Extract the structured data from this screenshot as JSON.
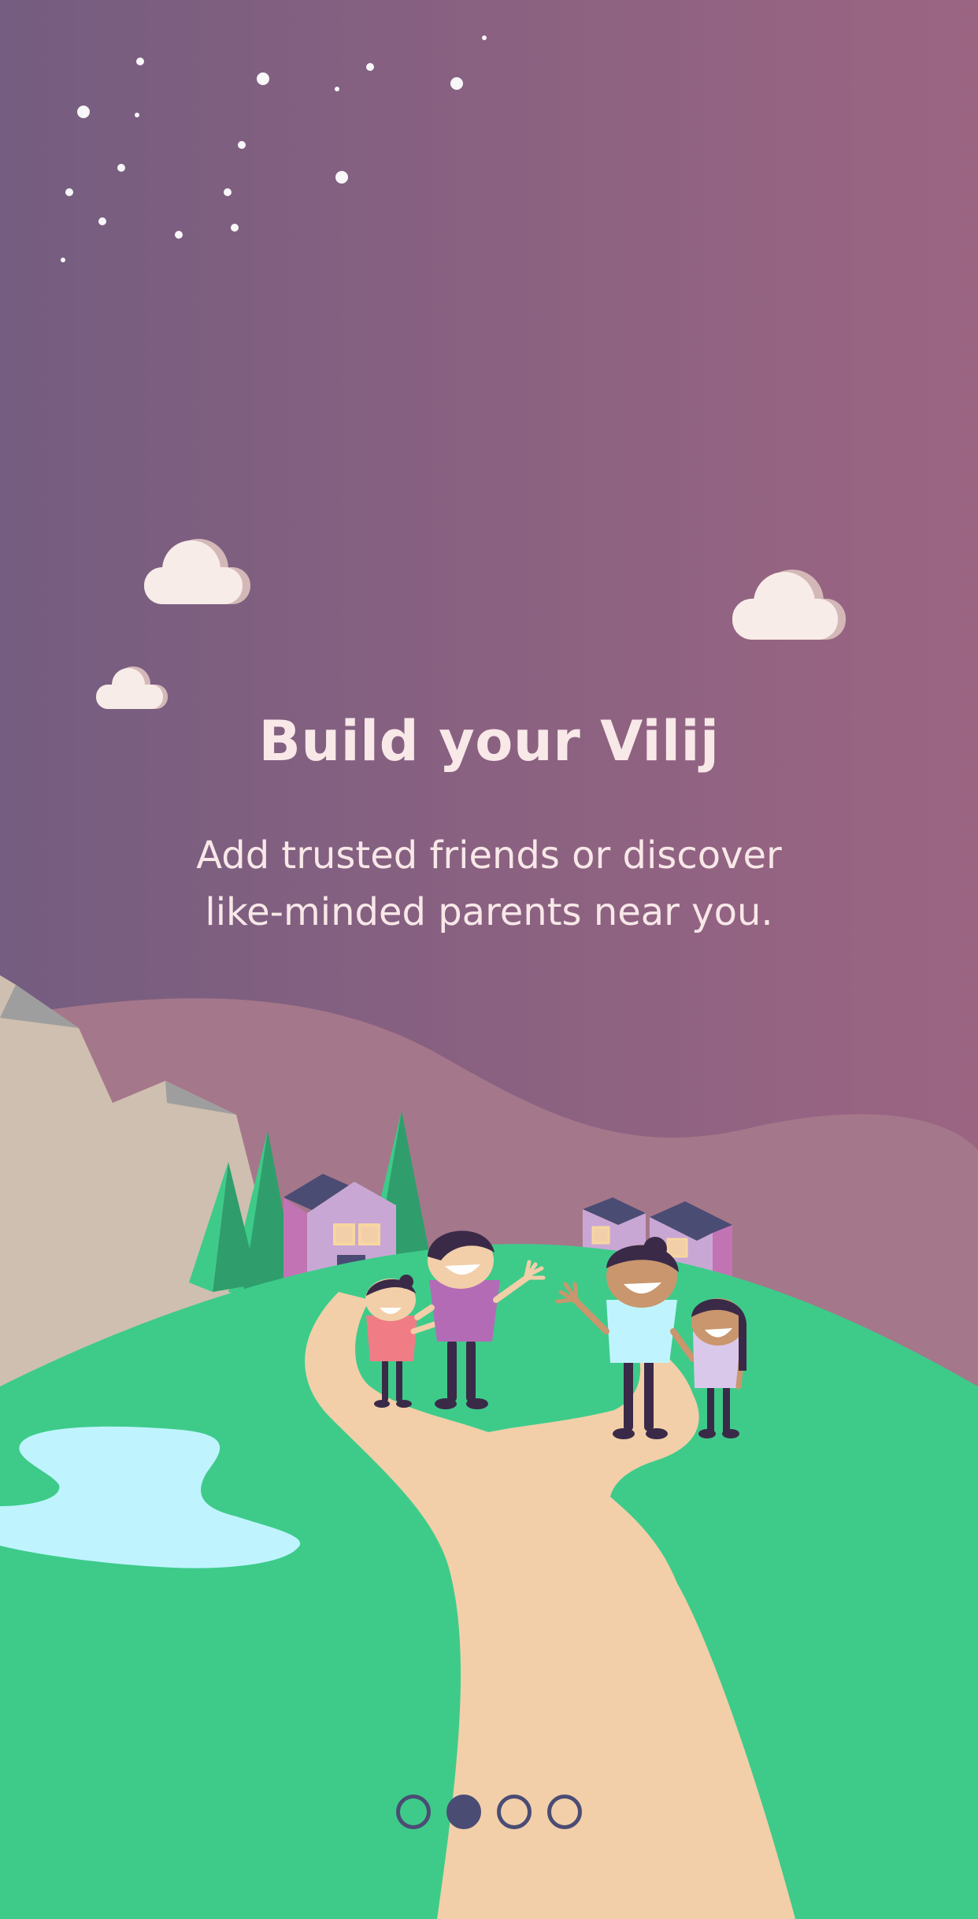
{
  "onboarding": {
    "title": "Build your Vilij",
    "subtitle_line1": "Add trusted friends or discover",
    "subtitle_line2": "like-minded parents near you."
  },
  "pagination": {
    "total": 4,
    "active_index": 1
  },
  "colors": {
    "sky_start": "#745d80",
    "sky_end": "#9b6582",
    "grass": "#3ecb8a",
    "path": "#f2cfa9",
    "lake": "#bff4ff",
    "mountain": "#cfbfb0",
    "cloud": "#f8ece8",
    "text": "#f8e8e8",
    "dot": "#4b4c74"
  },
  "illustration": {
    "icons": [
      "star-icon",
      "cloud-icon",
      "mountain-icon",
      "tree-icon",
      "house-icon",
      "lake-icon",
      "family-icon"
    ]
  }
}
